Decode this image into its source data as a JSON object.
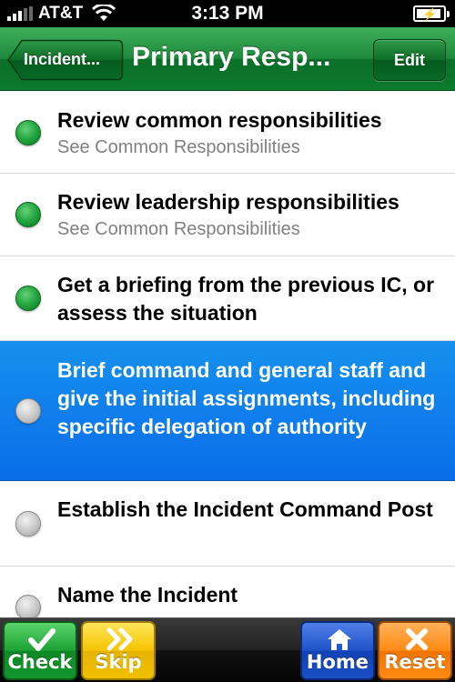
{
  "status_bar": {
    "carrier": "AT&T",
    "time": "3:13 PM"
  },
  "nav": {
    "back_label": "Incident...",
    "title": "Primary Resp...",
    "edit_label": "Edit"
  },
  "items": [
    {
      "title": "Review common responsibilities",
      "subtitle": "See Common Responsibilities",
      "checked": true,
      "selected": false
    },
    {
      "title": "Review leadership responsibilities",
      "subtitle": "See Common Responsibilities",
      "checked": true,
      "selected": false
    },
    {
      "title": "Get a briefing from the previous IC, or assess the situation",
      "subtitle": "",
      "checked": true,
      "selected": false
    },
    {
      "title": "Brief command and general staff and give the initial assignments, including specific delegation of authority",
      "subtitle": "",
      "checked": false,
      "selected": true
    },
    {
      "title": "Establish the Incident Command Post",
      "subtitle": "",
      "checked": false,
      "selected": false
    },
    {
      "title": "Name the Incident",
      "subtitle": "",
      "checked": false,
      "selected": false
    }
  ],
  "toolbar": {
    "check_label": "Check",
    "skip_label": "Skip",
    "home_label": "Home",
    "reset_label": "Reset"
  },
  "colors": {
    "nav_green": "#1d8a3b",
    "selected_blue": "#0b6de9",
    "check_green": "#1ca234",
    "skip_yellow": "#f5c400",
    "home_blue": "#1f52c8",
    "reset_orange": "#ff8a14"
  },
  "icons": {
    "wifi": "wifi-icon",
    "battery": "battery-charging-icon",
    "check": "checkmark-icon",
    "skip": "double-chevron-icon",
    "home": "house-icon",
    "reset": "x-icon"
  }
}
